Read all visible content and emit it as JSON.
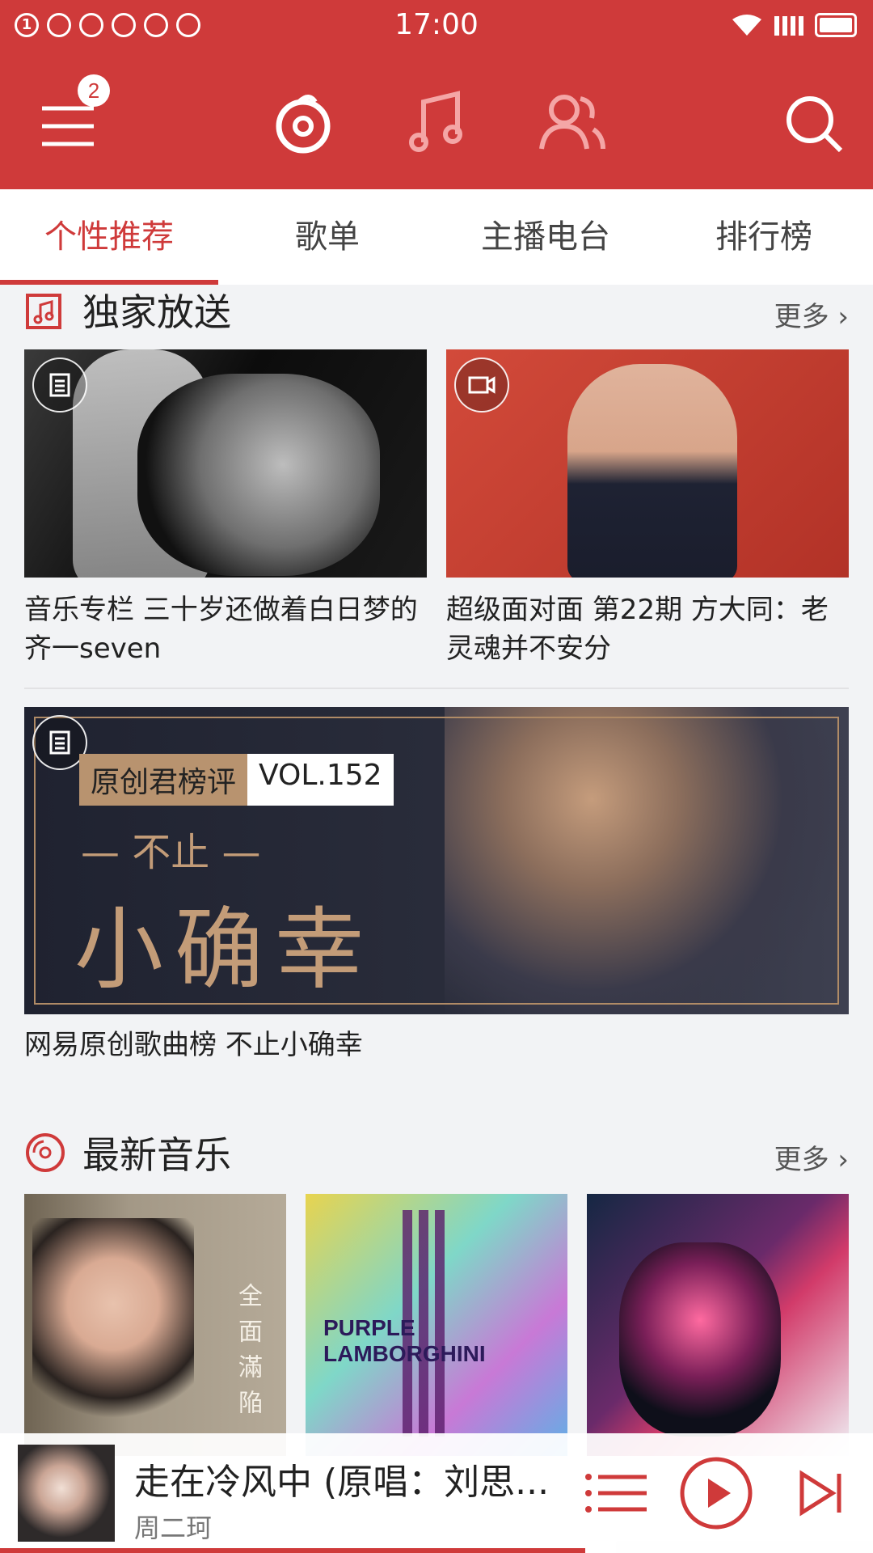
{
  "status_bar": {
    "time": "17:00",
    "notif_count": "1"
  },
  "app_bar": {
    "badge": "2"
  },
  "tabs": [
    {
      "label": "个性推荐"
    },
    {
      "label": "歌单"
    },
    {
      "label": "主播电台"
    },
    {
      "label": "排行榜"
    }
  ],
  "sections": {
    "exclusive": {
      "title": "独家放送",
      "more": "更多"
    },
    "new_music": {
      "title": "最新音乐",
      "more": "更多"
    }
  },
  "exclusive_cards": [
    {
      "caption": "音乐专栏 三十岁还做着白日梦的齐一seven",
      "badge_icon": "article-icon"
    },
    {
      "caption": "超级面对面 第22期 方大同：老灵魂并不安分",
      "badge_icon": "video-icon"
    }
  ],
  "banner": {
    "tag_left": "原创君榜评",
    "tag_right": "VOL.152",
    "sub": "— 不止 —",
    "big": "小确幸",
    "caption": "网易原创歌曲榜  不止小确幸"
  },
  "albums": [
    {
      "cover_text": "全面滿陥"
    },
    {
      "cover_text": "PURPLE LAMBORGHINI"
    },
    {
      "cover_text": ""
    }
  ],
  "player": {
    "song": "走在冷风中 (原唱：刘思...",
    "artist": "周二珂",
    "progress": 0.67
  },
  "colors": {
    "accent": "#cf3a3a"
  }
}
